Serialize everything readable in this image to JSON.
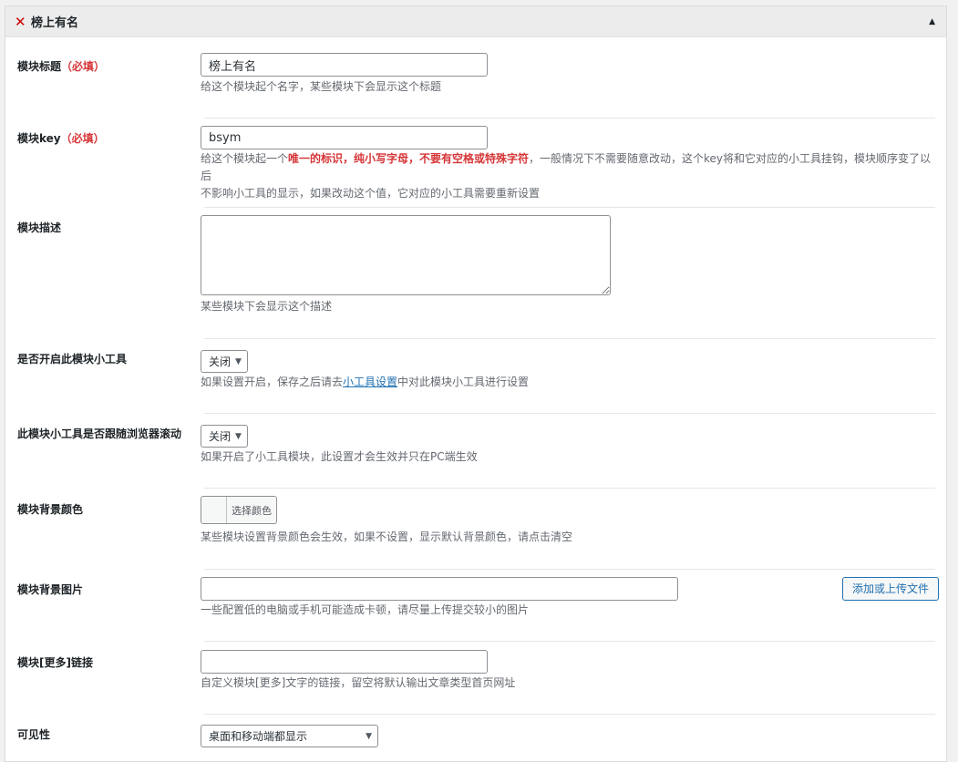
{
  "panel": {
    "title": "榜上有名"
  },
  "fields": {
    "title": {
      "label": "模块标题",
      "required": "（必填）",
      "value": "榜上有名",
      "desc": "给这个模块起个名字，某些模块下会显示这个标题"
    },
    "key": {
      "label": "模块key",
      "required": "（必填）",
      "value": "bsym",
      "desc_before": "给这个模块起一个",
      "desc_bold": "唯一的标识，纯小写字母，不要有空格或特殊字符",
      "desc_after1": "，一般情况下不需要随意改动，这个key将和它对应的小工具挂钩，模块顺序变了以后",
      "desc_after2": "不影响小工具的显示，如果改动这个值，它对应的小工具需要重新设置"
    },
    "description": {
      "label": "模块描述",
      "value": "",
      "desc": "某些模块下会显示这个描述"
    },
    "widget_enable": {
      "label": "是否开启此模块小工具",
      "value": "关闭",
      "desc_before": "如果设置开启，保存之后请去",
      "desc_link": "小工具设置",
      "desc_after": "中对此模块小工具进行设置"
    },
    "widget_scroll": {
      "label": "此模块小工具是否跟随浏览器滚动",
      "value": "关闭",
      "desc": "如果开启了小工具模块，此设置才会生效并只在PC端生效"
    },
    "bg_color": {
      "label": "模块背景颜色",
      "button": "选择颜色",
      "swatch_color": "#f6f7f7",
      "desc": "某些模块设置背景颜色会生效，如果不设置，显示默认背景颜色，请点击清空"
    },
    "bg_image": {
      "label": "模块背景图片",
      "value": "",
      "button": "添加或上传文件",
      "desc": "一些配置低的电脑或手机可能造成卡顿，请尽量上传提交较小的图片"
    },
    "more_link": {
      "label": "模块[更多]链接",
      "value": "",
      "desc": "自定义模块[更多]文字的链接，留空将默认输出文章类型首页网址"
    },
    "visibility": {
      "label": "可见性",
      "value": "桌面和移动端都显示"
    }
  }
}
